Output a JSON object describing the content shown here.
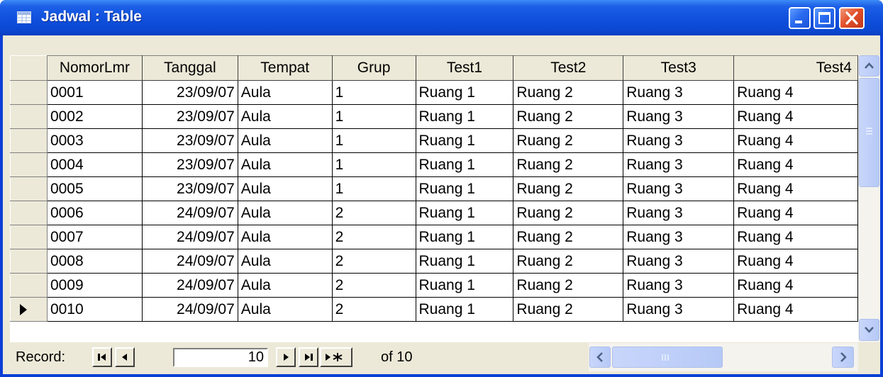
{
  "window": {
    "title": "Jadwal : Table"
  },
  "columns": [
    "NomorLmr",
    "Tanggal",
    "Tempat",
    "Grup",
    "Test1",
    "Test2",
    "Test3",
    "Test4"
  ],
  "rows": [
    [
      "0001",
      "23/09/07",
      "Aula",
      "1",
      "Ruang 1",
      "Ruang 2",
      "Ruang 3",
      "Ruang 4"
    ],
    [
      "0002",
      "23/09/07",
      "Aula",
      "1",
      "Ruang 1",
      "Ruang 2",
      "Ruang 3",
      "Ruang 4"
    ],
    [
      "0003",
      "23/09/07",
      "Aula",
      "1",
      "Ruang 1",
      "Ruang 2",
      "Ruang 3",
      "Ruang 4"
    ],
    [
      "0004",
      "23/09/07",
      "Aula",
      "1",
      "Ruang 1",
      "Ruang 2",
      "Ruang 3",
      "Ruang 4"
    ],
    [
      "0005",
      "23/09/07",
      "Aula",
      "1",
      "Ruang 1",
      "Ruang 2",
      "Ruang 3",
      "Ruang 4"
    ],
    [
      "0006",
      "24/09/07",
      "Aula",
      "2",
      "Ruang 1",
      "Ruang 2",
      "Ruang 3",
      "Ruang 4"
    ],
    [
      "0007",
      "24/09/07",
      "Aula",
      "2",
      "Ruang 1",
      "Ruang 2",
      "Ruang 3",
      "Ruang 4"
    ],
    [
      "0008",
      "24/09/07",
      "Aula",
      "2",
      "Ruang 1",
      "Ruang 2",
      "Ruang 3",
      "Ruang 4"
    ],
    [
      "0009",
      "24/09/07",
      "Aula",
      "2",
      "Ruang 1",
      "Ruang 2",
      "Ruang 3",
      "Ruang 4"
    ],
    [
      "0010",
      "24/09/07",
      "Aula",
      "2",
      "Ruang 1",
      "Ruang 2",
      "Ruang 3",
      "Ruang 4"
    ]
  ],
  "current_row_index": 9,
  "navigation": {
    "label": "Record:",
    "current": "10",
    "total_text": "of  10"
  },
  "icons": {
    "app": "table-icon",
    "minimize": "minimize-icon",
    "maximize": "maximize-icon",
    "close": "close-icon",
    "first": "first-record-icon",
    "prev": "prev-record-icon",
    "next": "next-record-icon",
    "last": "last-record-icon",
    "new": "new-record-icon"
  }
}
